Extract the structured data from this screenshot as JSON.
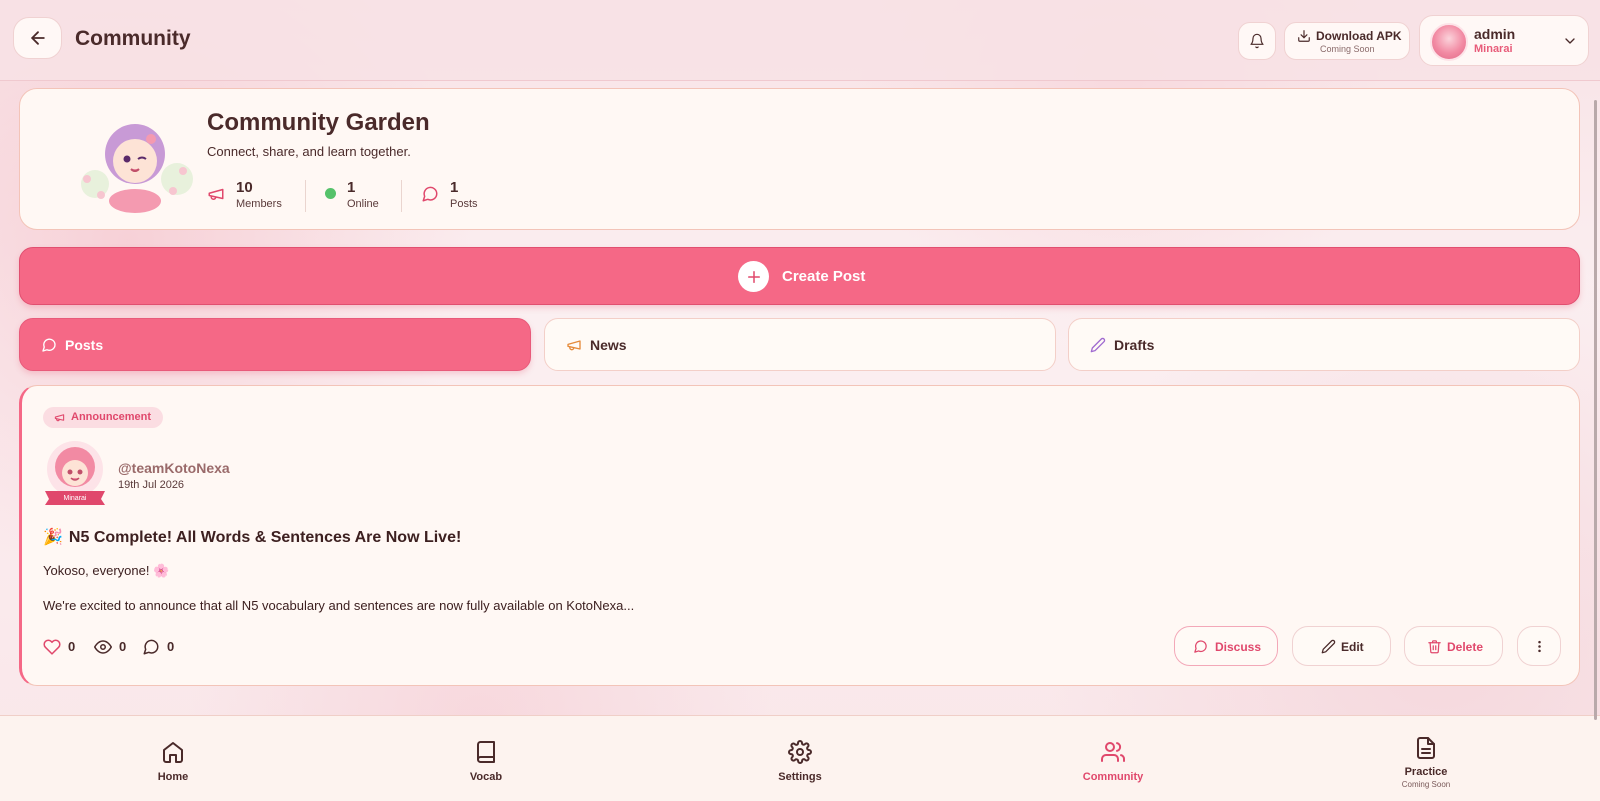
{
  "header": {
    "title": "Community",
    "apk_label": "Download APK",
    "apk_sub": "Coming Soon",
    "user": {
      "name": "admin",
      "rank": "Minarai"
    }
  },
  "community": {
    "title": "Community Garden",
    "subtitle": "Connect, share, and learn together.",
    "stats": [
      {
        "value": "10",
        "label": "Members",
        "icon": "megaphone-icon"
      },
      {
        "value": "1",
        "label": "Online",
        "icon": "online-dot"
      },
      {
        "value": "1",
        "label": "Posts",
        "icon": "chat-bubble-icon"
      }
    ]
  },
  "create_post": {
    "label": "Create Post"
  },
  "tabs": [
    {
      "label": "Posts",
      "icon": "chat-bubble-icon",
      "active": true
    },
    {
      "label": "News",
      "icon": "megaphone-icon",
      "active": false
    },
    {
      "label": "Drafts",
      "icon": "pencil-icon",
      "active": false
    }
  ],
  "post": {
    "tag": "Announcement",
    "author_handle": "@teamKotoNexa",
    "author_rank": "Minarai",
    "date": "19th Jul 2026",
    "title": "N5 Complete! All Words & Sentences Are Now Live!",
    "line1": "Yokoso, everyone! 🌸",
    "line2": "We're excited to announce that all N5 vocabulary and sentences are now fully available on KotoNexa...",
    "likes": "0",
    "views": "0",
    "comments": "0",
    "actions": {
      "discuss": "Discuss",
      "edit": "Edit",
      "delete": "Delete"
    }
  },
  "bottom_nav": [
    {
      "label": "Home",
      "icon": "home-icon",
      "active": false
    },
    {
      "label": "Vocab",
      "icon": "book-icon",
      "active": false
    },
    {
      "label": "Settings",
      "icon": "gear-icon",
      "active": false
    },
    {
      "label": "Community",
      "icon": "users-icon",
      "active": true
    },
    {
      "label": "Practice",
      "sub": "Coming Soon",
      "icon": "document-icon",
      "active": false
    }
  ],
  "colors": {
    "accent": "#f56886",
    "accent_text": "#e0486c",
    "text": "#4a2a2a",
    "card_bg": "#fff8f4",
    "online": "#55c26a"
  }
}
